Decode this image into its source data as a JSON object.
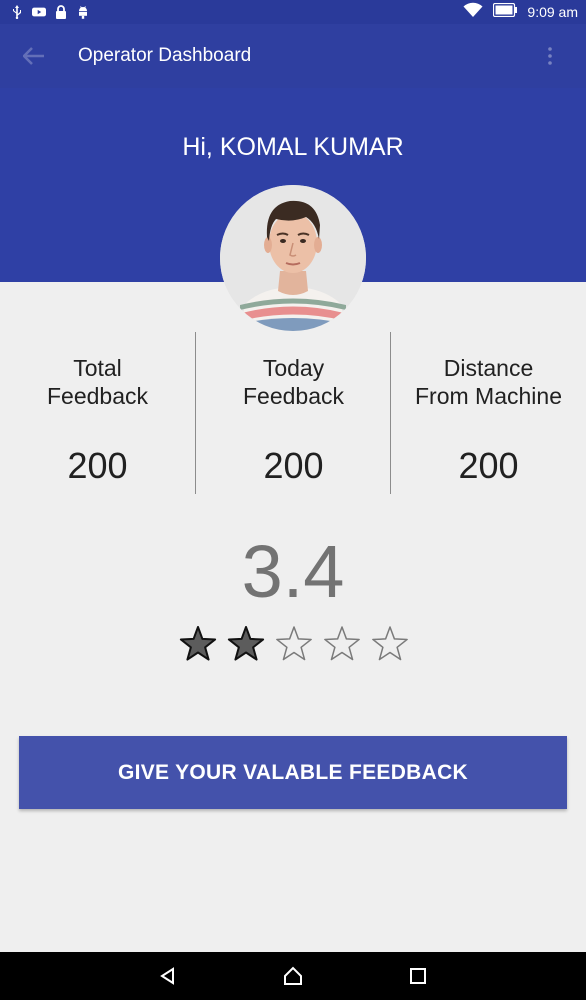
{
  "status_bar": {
    "time": "9:09 am",
    "left_icons": [
      "usb-icon",
      "youtube-icon",
      "lock-icon",
      "android-debug-icon"
    ],
    "right_icons": [
      "wifi-icon",
      "battery-icon"
    ]
  },
  "toolbar": {
    "title": "Operator Dashboard",
    "back_icon": "back-arrow-icon",
    "menu_icon": "overflow-menu-icon"
  },
  "header": {
    "greeting": "Hi, KOMAL KUMAR"
  },
  "stats": [
    {
      "label": "Total\nFeedback",
      "value": "200"
    },
    {
      "label": "Today\nFeedback",
      "value": "200"
    },
    {
      "label": "Distance\nFrom Machine",
      "value": "200"
    }
  ],
  "rating": {
    "value": "3.4",
    "filled_stars": 2,
    "total_stars": 5
  },
  "feedback_button": {
    "label": "GIVE YOUR VALABLE FEEDBACK"
  },
  "colors": {
    "primary": "#2f40a5",
    "primary_dark": "#2a3a9a",
    "button": "#4452ab",
    "background": "#efefef"
  },
  "nav_bar": {
    "icons": [
      "back-triangle-icon",
      "home-circle-icon",
      "recents-square-icon"
    ]
  }
}
